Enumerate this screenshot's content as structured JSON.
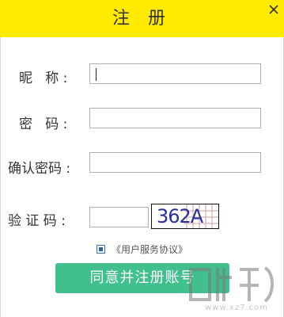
{
  "window": {
    "title": "注 册"
  },
  "form": {
    "nickname_label": "昵   称 :",
    "password_label": "密   码 :",
    "confirm_label": "确认密码 :",
    "captcha_label": "验 证 码 :",
    "nickname_value": "",
    "password_value": "",
    "confirm_value": "",
    "captcha_value": ""
  },
  "captcha": {
    "code": "362A"
  },
  "agreement": {
    "checked": true,
    "text": "《用户服务协议》"
  },
  "submit": {
    "label": "同意并注册账号"
  },
  "watermark": {
    "site": "www.xz7.com"
  },
  "colors": {
    "titlebar": "#ffea00",
    "button": "#41c08e",
    "captcha_text": "#2a2f9a"
  }
}
